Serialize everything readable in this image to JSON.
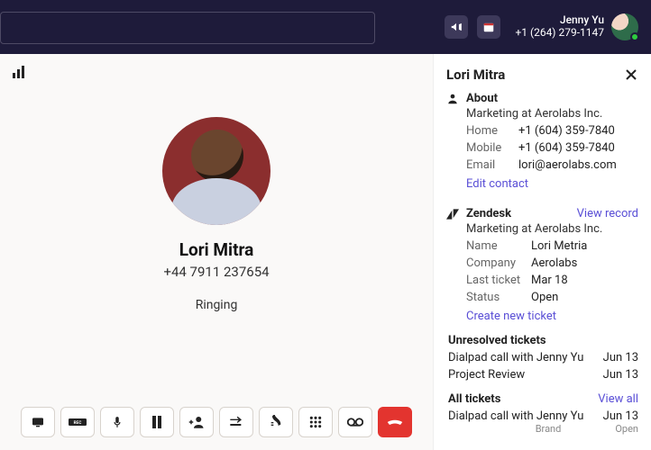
{
  "header": {
    "search_placeholder": "",
    "user": {
      "name": "Jenny Yu",
      "phone": "+1 (264) 279-1147"
    }
  },
  "call": {
    "name": "Lori Mitra",
    "number": "+44 7911 237654",
    "status": "Ringing"
  },
  "panel": {
    "title": "Lori Mitra",
    "about": {
      "heading": "About",
      "subtitle": "Marketing at Aerolabs Inc.",
      "rows": [
        {
          "label": "Home",
          "value": "+1 (604) 359-7840"
        },
        {
          "label": "Mobile",
          "value": "+1 (604) 359-7840"
        },
        {
          "label": "Email",
          "value": "lori@aerolabs.com"
        }
      ],
      "edit_label": "Edit contact"
    },
    "zendesk": {
      "heading": "Zendesk",
      "view_label": "View record",
      "subtitle": "Marketing at Aerolabs Inc.",
      "rows": [
        {
          "label": "Name",
          "value": "Lori Metria"
        },
        {
          "label": "Company",
          "value": "Aerolabs"
        },
        {
          "label": "Last ticket",
          "value": "Mar 18"
        },
        {
          "label": "Status",
          "value": "Open"
        }
      ],
      "create_label": "Create new ticket"
    },
    "unresolved": {
      "heading": "Unresolved tickets",
      "items": [
        {
          "title": "Dialpad call with Jenny Yu",
          "date": "Jun 13"
        },
        {
          "title": "Project Review",
          "date": "Jun 13"
        }
      ]
    },
    "all": {
      "heading": "All tickets",
      "view_all": "View all",
      "items": [
        {
          "title": "Dialpad call with Jenny Yu",
          "date": "Jun 13",
          "brand": "Brand",
          "status": "Open"
        }
      ]
    }
  }
}
